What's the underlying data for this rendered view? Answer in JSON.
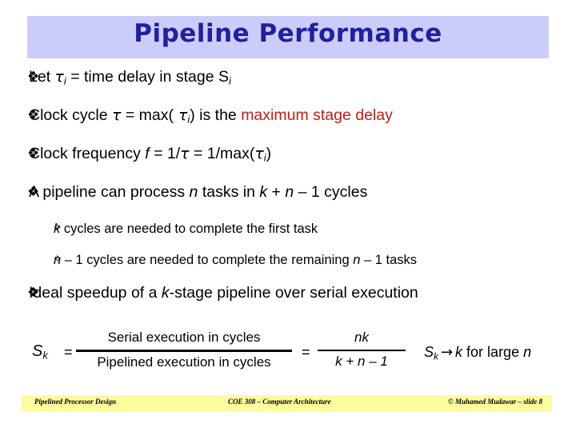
{
  "slide": {
    "title": "Pipeline Performance",
    "title_band_color": "#CCCCFA",
    "title_text_color": "#21219C",
    "accent_red": "#BE1E16",
    "footer_band_color": "#FCFC9E"
  },
  "bullets": {
    "glyph_level1": "❖",
    "glyph_level2": "✧",
    "items": [
      {
        "level": 1,
        "glyph_name": "diamond-bullet-icon",
        "text": "Let τi = time delay in stage Si",
        "parts": [
          {
            "t": "Let ",
            "style": "plain"
          },
          {
            "t": "τ",
            "style": "tau"
          },
          {
            "t": "i",
            "style": "sub"
          },
          {
            "t": " = time delay in stage ",
            "style": "plain"
          },
          {
            "t": "S",
            "style": "plain"
          },
          {
            "t": "i",
            "style": "sub"
          }
        ]
      },
      {
        "level": 1,
        "glyph_name": "diamond-bullet-icon",
        "text": "Clock cycle τ = max( τi) is the maximum stage delay",
        "parts": [
          {
            "t": "Clock cycle ",
            "style": "plain"
          },
          {
            "t": "τ",
            "style": "tau"
          },
          {
            "t": " = max(",
            "style": "plain"
          },
          {
            "t": " τ",
            "style": "tau"
          },
          {
            "t": "i",
            "style": "sub"
          },
          {
            "t": ") is the ",
            "style": "plain"
          },
          {
            "t": "maximum stage delay",
            "style": "red"
          }
        ]
      },
      {
        "level": 1,
        "glyph_name": "diamond-bullet-icon",
        "text": "Clock frequency f = 1/τ = 1/max(τi)",
        "parts": [
          {
            "t": "Clock frequency ",
            "style": "plain"
          },
          {
            "t": "f",
            "style": "italic"
          },
          {
            "t": " =  1/",
            "style": "plain"
          },
          {
            "t": "τ",
            "style": "tau"
          },
          {
            "t": " =  1/max(",
            "style": "plain"
          },
          {
            "t": "τ",
            "style": "tau"
          },
          {
            "t": "i",
            "style": "sub"
          },
          {
            "t": ")",
            "style": "plain"
          }
        ]
      },
      {
        "level": 1,
        "glyph_name": "diamond-bullet-icon",
        "text": "A pipeline can process n tasks in k + n – 1 cycles",
        "parts": [
          {
            "t": "A pipeline can process ",
            "style": "plain"
          },
          {
            "t": "n",
            "style": "italic"
          },
          {
            "t": " tasks in ",
            "style": "plain"
          },
          {
            "t": "k",
            "style": "italic"
          },
          {
            "t": " + ",
            "style": "plain"
          },
          {
            "t": "n",
            "style": "italic"
          },
          {
            "t": " – 1 cycles",
            "style": "plain"
          }
        ]
      },
      {
        "level": 2,
        "glyph_name": "star-bullet-icon",
        "text": "k cycles are needed to complete the first task",
        "parts": [
          {
            "t": "k",
            "style": "italic"
          },
          {
            "t": " cycles are needed to complete the first task",
            "style": "plain"
          }
        ]
      },
      {
        "level": 2,
        "glyph_name": "star-bullet-icon",
        "text": "n – 1 cycles are needed to complete the remaining n – 1 tasks",
        "parts": [
          {
            "t": "n",
            "style": "italic"
          },
          {
            "t": " – 1 cycles are needed to complete the remaining ",
            "style": "plain"
          },
          {
            "t": "n",
            "style": "italic"
          },
          {
            "t": " – 1 tasks",
            "style": "plain"
          }
        ]
      },
      {
        "level": 1,
        "glyph_name": "diamond-bullet-icon",
        "text": "Ideal speedup of a k-stage pipeline over serial execution",
        "parts": [
          {
            "t": "Ideal speedup of a ",
            "style": "plain"
          },
          {
            "t": "k",
            "style": "italic"
          },
          {
            "t": "-stage pipeline over serial execution",
            "style": "plain"
          }
        ]
      }
    ]
  },
  "formula": {
    "sk_label": "S",
    "sk_sub": "k",
    "equals_1": "=",
    "fraction_1": {
      "numerator": "Serial execution in cycles",
      "denominator": "Pipelined execution in cycles"
    },
    "equals_2": "=",
    "fraction_2": {
      "numerator": "nk",
      "denominator": "k + n – 1"
    },
    "limit": {
      "sk_label": "S",
      "sk_sub": "k",
      "arrow": "→",
      "target": "k",
      "tail": " for large ",
      "variable": "n"
    }
  },
  "footer": {
    "left": "Pipelined Processor Design",
    "center": "COE 308 – Computer Architecture",
    "right": "© Muhamed Mudawar – slide 8"
  }
}
